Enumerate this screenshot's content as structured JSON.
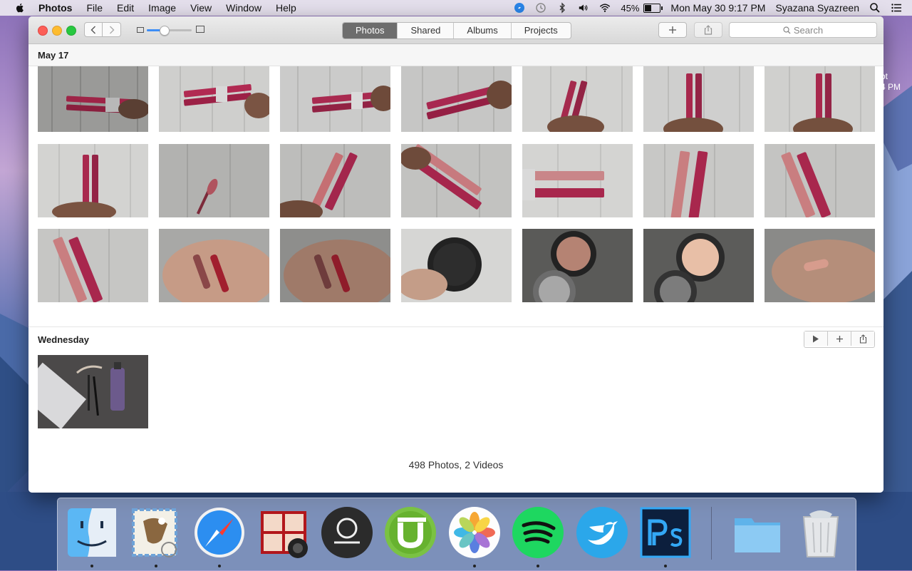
{
  "menubar": {
    "app_name": "Photos",
    "menus": [
      "File",
      "Edit",
      "Image",
      "View",
      "Window",
      "Help"
    ],
    "battery_percent": "45%",
    "battery_level": 0.45,
    "clock": "Mon May 30  9:17 PM",
    "user": "Syazana Syazreen",
    "icons": [
      "safari-sync-icon",
      "time-machine-icon",
      "bluetooth-icon",
      "volume-icon",
      "wifi-icon",
      "battery-icon",
      "spotlight-icon",
      "notification-center-icon"
    ]
  },
  "toolbar": {
    "tabs": [
      {
        "label": "Photos",
        "active": true
      },
      {
        "label": "Shared",
        "active": false
      },
      {
        "label": "Albums",
        "active": false
      },
      {
        "label": "Projects",
        "active": false
      }
    ],
    "zoom_level": 0.38,
    "search_placeholder": "Search"
  },
  "library": {
    "sections": [
      {
        "title": "May 17",
        "photo_count": 21
      },
      {
        "title": "Wednesday",
        "photo_count": 1
      }
    ],
    "summary": "498 Photos, 2 Videos"
  },
  "desktop": {
    "peek_text": "ot\n4 PM"
  },
  "dock": {
    "apps": [
      {
        "name": "Finder",
        "running": true
      },
      {
        "name": "Mail",
        "running": true
      },
      {
        "name": "Safari",
        "running": true
      },
      {
        "name": "Photo Booth",
        "running": false
      },
      {
        "name": "OBS",
        "running": false
      },
      {
        "name": "uTorrent",
        "running": false
      },
      {
        "name": "Photos",
        "running": true
      },
      {
        "name": "Spotify",
        "running": true
      },
      {
        "name": "Twitter",
        "running": false
      },
      {
        "name": "Photoshop",
        "running": true
      },
      {
        "name": "Folder",
        "running": false
      },
      {
        "name": "Trash",
        "running": false
      }
    ]
  }
}
